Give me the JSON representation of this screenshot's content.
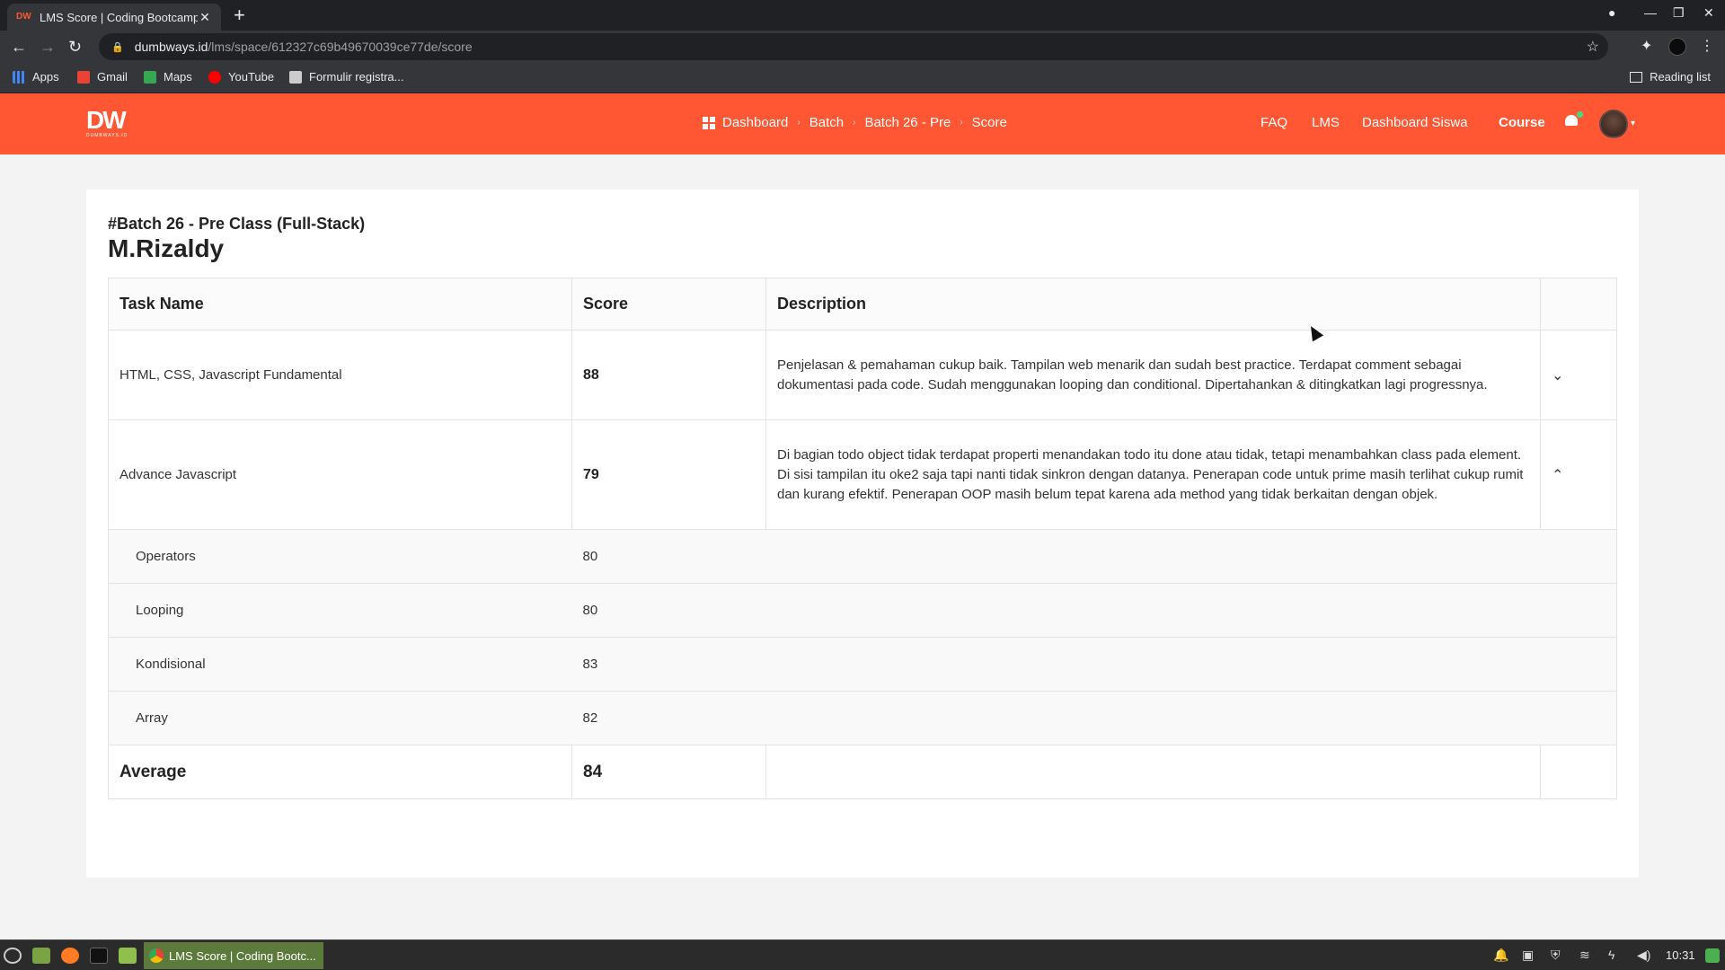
{
  "browser": {
    "tab_title": "LMS Score | Coding Bootcamp",
    "url_host": "dumbways.id",
    "url_path": "/lms/space/612327c69b49670039ce77de/score",
    "bookmarks": [
      "Apps",
      "Gmail",
      "Maps",
      "YouTube",
      "Formulir registra..."
    ],
    "reading_list": "Reading list"
  },
  "header": {
    "logo_text": "DW",
    "logo_sub": "DUMBWAYS.ID",
    "breadcrumbs": [
      "Dashboard",
      "Batch",
      "Batch 26 - Pre",
      "Score"
    ],
    "nav": [
      "FAQ",
      "LMS",
      "Dashboard Siswa",
      "Course"
    ],
    "accent": "#ff5733"
  },
  "page": {
    "batch_title": "#Batch 26 - Pre Class (Full-Stack)",
    "student_name": "M.Rizaldy",
    "columns": [
      "Task Name",
      "Score",
      "Description"
    ],
    "tasks": [
      {
        "name": "HTML, CSS, Javascript Fundamental",
        "score": "88",
        "description": "Penjelasan & pemahaman cukup baik. Tampilan web menarik dan sudah best practice. Terdapat comment sebagai dokumentasi pada code. Sudah menggunakan looping dan conditional. Dipertahankan & ditingkatkan lagi progressnya.",
        "expanded": false
      },
      {
        "name": "Advance Javascript",
        "score": "79",
        "description": "Di bagian todo object tidak terdapat properti menandakan todo itu done atau tidak, tetapi menambahkan class pada element. Di sisi tampilan itu oke2 saja tapi nanti tidak sinkron dengan datanya. Penerapan code untuk prime masih terlihat cukup rumit dan kurang efektif. Penerapan OOP masih belum tepat karena ada method yang tidak berkaitan dengan objek.",
        "expanded": true,
        "subtasks": [
          {
            "name": "Operators",
            "score": "80"
          },
          {
            "name": "Looping",
            "score": "80"
          },
          {
            "name": "Kondisional",
            "score": "83"
          },
          {
            "name": "Array",
            "score": "82"
          }
        ]
      }
    ],
    "average_label": "Average",
    "average_value": "84"
  },
  "taskbar": {
    "active_app": "LMS Score | Coding Bootc...",
    "clock": "10:31"
  }
}
